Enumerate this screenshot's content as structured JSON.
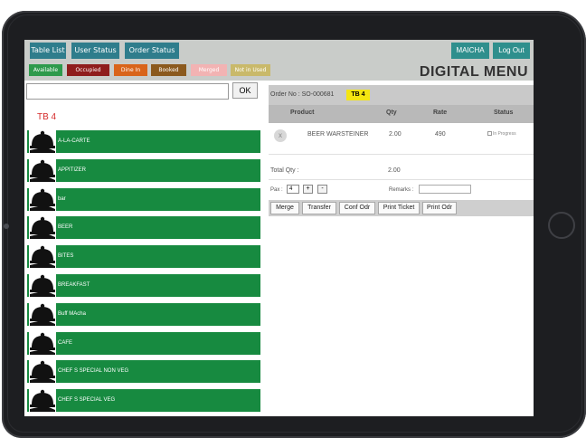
{
  "nav": {
    "table_list": "Table List",
    "user_status": "User Status",
    "order_status": "Order Status",
    "user": "MAICHA",
    "logout": "Log Out"
  },
  "legend": {
    "available": "Available",
    "occupied": "Occupied",
    "dine_in": "Dine In",
    "booked": "Booked",
    "merged": "Merged",
    "not_in_used": "Not in Used"
  },
  "brand": "DIGITAL MENU",
  "search": {
    "value": "",
    "button": "OK"
  },
  "table_label": "TB 4",
  "categories": [
    {
      "label": "A-LA-CARTE",
      "icon": "cloche-serving-icon"
    },
    {
      "label": "APPITIZER",
      "icon": "cloche-serving-icon"
    },
    {
      "label": "bar",
      "icon": "cloche-serving-icon"
    },
    {
      "label": "BEER",
      "icon": "cloche-serving-icon"
    },
    {
      "label": "BITES",
      "icon": "cloche-serving-icon"
    },
    {
      "label": "BREAKFAST",
      "icon": "cloche-serving-icon"
    },
    {
      "label": "Buff MAcha",
      "icon": "cloche-serving-icon"
    },
    {
      "label": "CAFE",
      "icon": "cloche-serving-icon"
    },
    {
      "label": "CHEF S SPECIAL NON VEG",
      "icon": "cloche-serving-icon"
    },
    {
      "label": "CHEF S SPECIAL VEG",
      "icon": "cloche-serving-icon"
    }
  ],
  "order": {
    "order_no": "Order No : SO-000681",
    "table_badge": "TB 4",
    "columns": {
      "product": "Product",
      "qty": "Qty",
      "rate": "Rate",
      "status": "Status"
    },
    "lines": [
      {
        "remove": "x",
        "product": "BEER WARSTEINER",
        "qty": "2.00",
        "rate": "490",
        "status": "In Progress"
      }
    ],
    "total_label": "Total Qty :",
    "total_value": "2.00",
    "pax_label": "Pax :",
    "pax_value": "4",
    "plus": "+",
    "minus": "-",
    "remarks_label": "Remarks :",
    "remarks_value": ""
  },
  "actions": {
    "merge": "Merge",
    "transfer": "Transfer",
    "conf_odr": "Conf Odr",
    "print_ticket": "Print Ticket",
    "print_odr": "Print Odr"
  },
  "colors": {
    "nav_button": "#2f7d8c",
    "available": "#2e9a4c",
    "occupied": "#8f1d1d",
    "dine_in": "#d9641a",
    "booked": "#8b5a1e",
    "merged": "#f2b3b3",
    "not_in_used": "#c9b96a",
    "category_green": "#178a40",
    "table_badge": "#f4e511"
  }
}
